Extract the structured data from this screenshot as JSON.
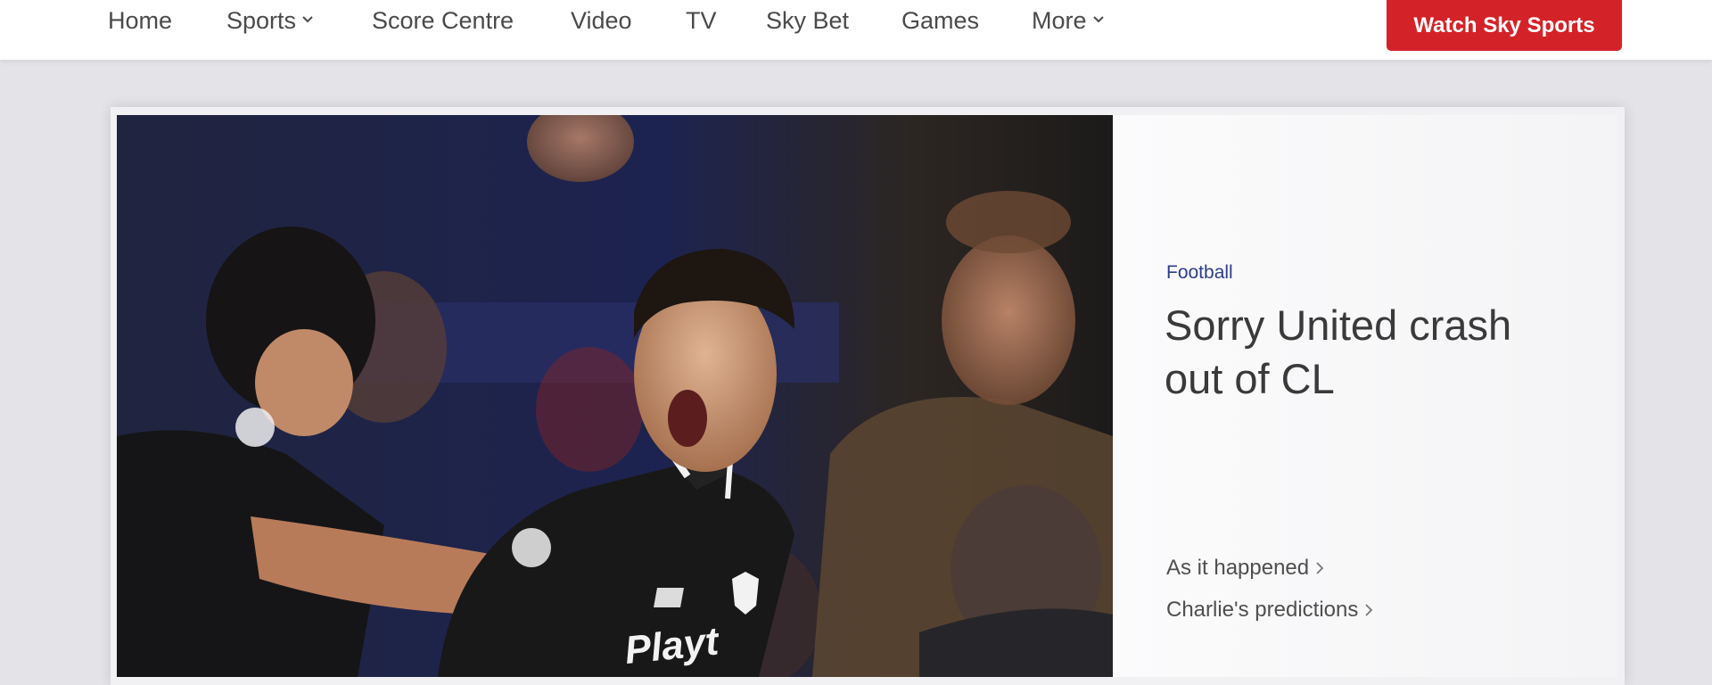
{
  "nav": {
    "items": [
      {
        "label": "Home"
      },
      {
        "label": "Sports"
      },
      {
        "label": "Score Centre"
      },
      {
        "label": "Video"
      },
      {
        "label": "TV"
      },
      {
        "label": "Sky Bet"
      },
      {
        "label": "Games"
      },
      {
        "label": "More"
      }
    ],
    "watch_label": "Watch Sky Sports"
  },
  "hero": {
    "category": "Football",
    "headline": "Sorry United crash out of CL",
    "links": [
      {
        "label": "As it happened"
      },
      {
        "label": "Charlie's predictions"
      }
    ]
  },
  "colors": {
    "accent_red": "#d42328",
    "category_blue": "#2c3c8c",
    "nav_text": "#4a4a4a"
  }
}
